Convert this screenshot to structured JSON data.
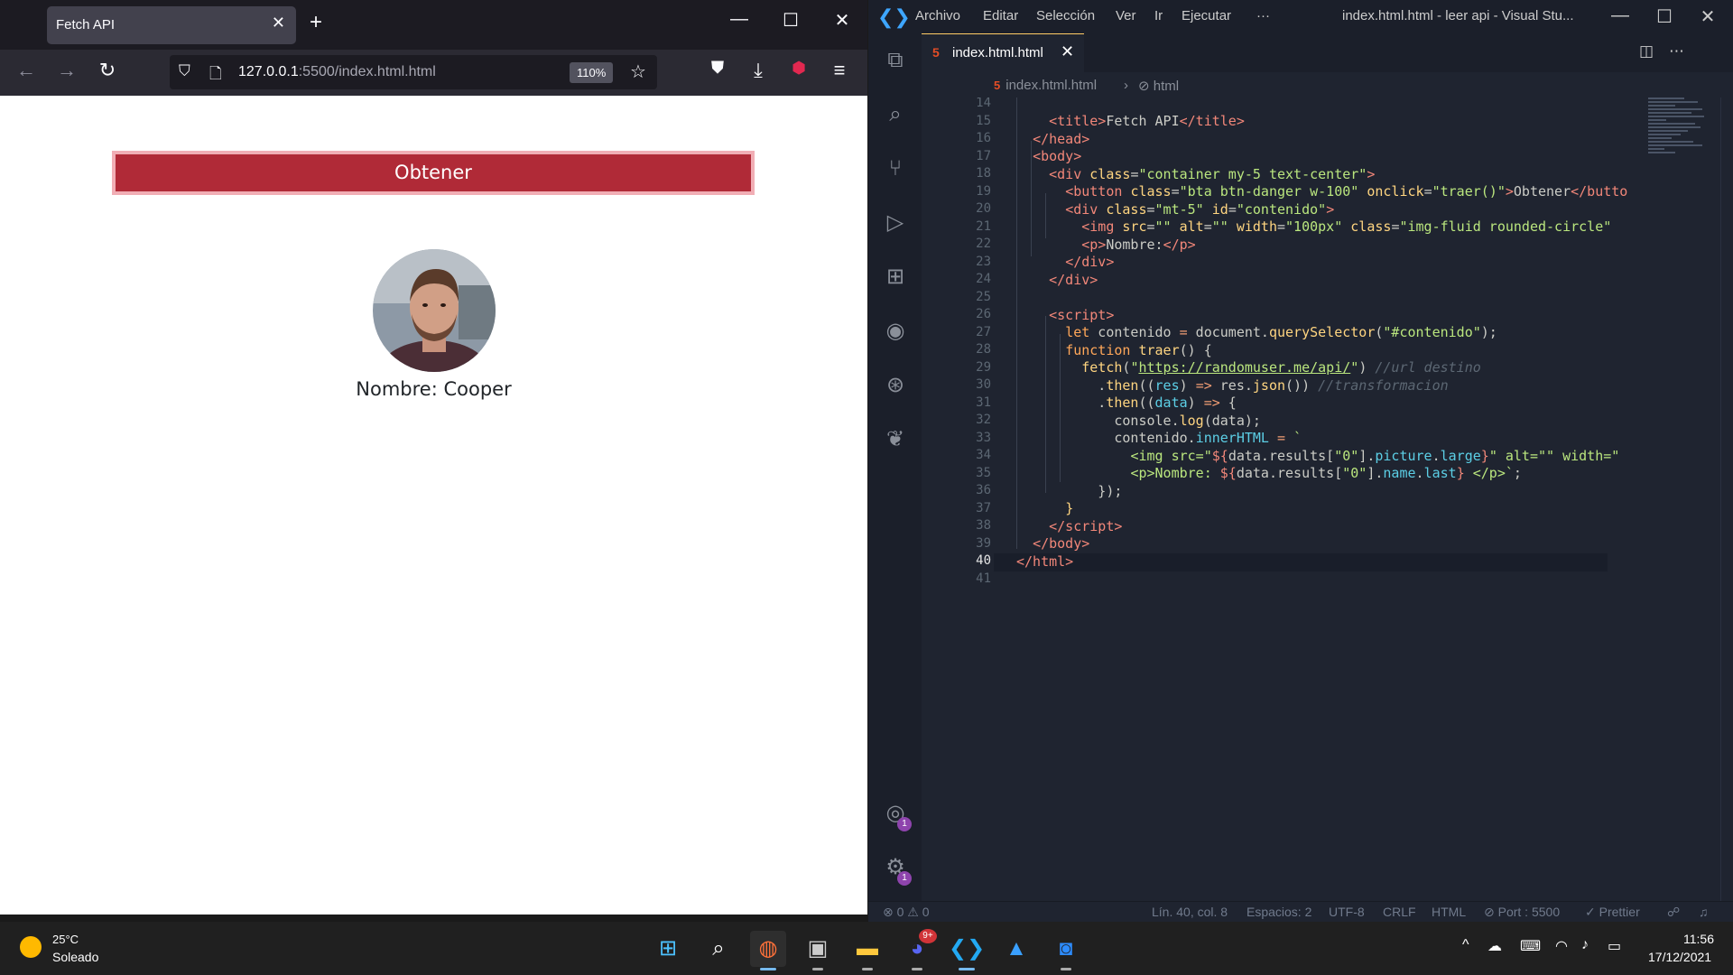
{
  "browser": {
    "tab_title": "Fetch API",
    "url_host": "127.0.0.1",
    "url_rest": ":5500/index.html.html",
    "zoom": "110%",
    "page": {
      "button_label": "Obtener",
      "name_text": "Nombre: Cooper"
    }
  },
  "vscode": {
    "menu": [
      "Archivo",
      "Editar",
      "Selección",
      "Ver",
      "Ir",
      "Ejecutar",
      "···"
    ],
    "window_title": "index.html.html - leer api - Visual Stu...",
    "tab_title": "index.html.html",
    "breadcrumb": [
      "index.html.html",
      "html"
    ],
    "current_line": "40",
    "line_numbers": [
      "14",
      "15",
      "16",
      "17",
      "18",
      "19",
      "20",
      "21",
      "22",
      "23",
      "24",
      "25",
      "26",
      "27",
      "28",
      "29",
      "30",
      "31",
      "32",
      "33",
      "34",
      "35",
      "36",
      "37",
      "38",
      "39",
      "40",
      "41"
    ],
    "status": {
      "problems": "⊗ 0 ⚠ 0",
      "position": "Lín. 40, col. 8",
      "spaces": "Espacios: 2",
      "encoding": "UTF-8",
      "eol": "CRLF",
      "language": "HTML",
      "port": "⊘ Port : 5500",
      "prettier": "✓ Prettier"
    },
    "badges": {
      "accounts": "1",
      "settings": "1"
    }
  },
  "taskbar": {
    "weather_temp": "25°C",
    "weather_desc": "Soleado",
    "time": "11:56",
    "date": "17/12/2021",
    "discord_badge": "9+"
  },
  "colors": {
    "btn_danger": "#b02a37",
    "editor_bg": "#1f2430",
    "accent_tab": "#ffcc66"
  }
}
